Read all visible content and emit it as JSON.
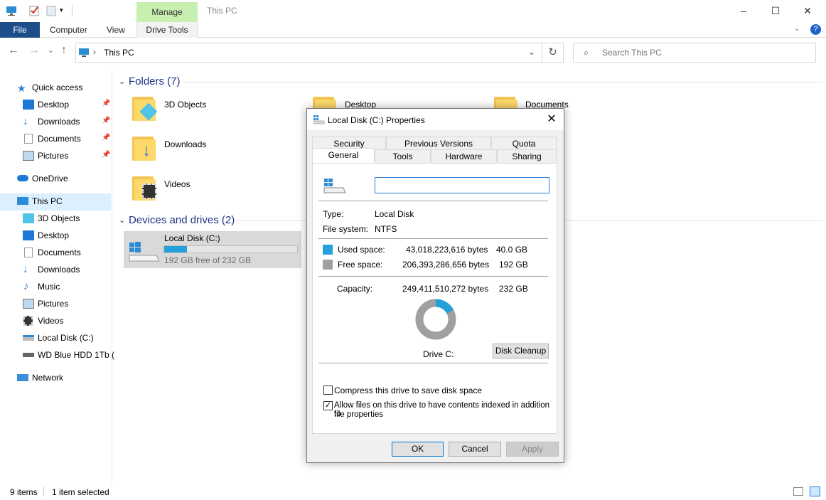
{
  "window": {
    "title": "This PC",
    "manage_tab": "Manage",
    "controls": {
      "minimize": "–",
      "maximize": "☐",
      "close": "✕"
    }
  },
  "ribbon": {
    "tabs": [
      "File",
      "Computer",
      "View",
      "Drive Tools"
    ]
  },
  "address": {
    "path": "This PC",
    "search_placeholder": "Search This PC"
  },
  "sidebar": {
    "quick_access": "Quick access",
    "quick_items": [
      "Desktop",
      "Downloads",
      "Documents",
      "Pictures"
    ],
    "onedrive": "OneDrive",
    "this_pc": "This PC",
    "pc_items": [
      "3D Objects",
      "Desktop",
      "Documents",
      "Downloads",
      "Music",
      "Pictures",
      "Videos",
      "Local Disk (C:)",
      "WD Blue HDD 1Tb ("
    ],
    "network": "Network"
  },
  "content": {
    "folders_header": "Folders (7)",
    "folders": [
      "3D Objects",
      "Desktop",
      "Documents",
      "Downloads",
      "Videos"
    ],
    "devices_header": "Devices and drives (2)",
    "drive": {
      "name": "Local Disk (C:)",
      "free_text": "192 GB free of 232 GB",
      "used_fraction": 0.17
    }
  },
  "status": {
    "items": "9 items",
    "selected": "1 item selected"
  },
  "dialog": {
    "title": "Local Disk (C:) Properties",
    "tabs_top": [
      "Security",
      "Previous Versions",
      "Quota"
    ],
    "tabs_bottom": [
      "General",
      "Tools",
      "Hardware",
      "Sharing"
    ],
    "name_value": "",
    "type_label": "Type:",
    "type_value": "Local Disk",
    "fs_label": "File system:",
    "fs_value": "NTFS",
    "used_label": "Used space:",
    "used_bytes": "43,018,223,616 bytes",
    "used_gb": "40.0 GB",
    "free_label": "Free space:",
    "free_bytes": "206,393,286,656 bytes",
    "free_gb": "192 GB",
    "capacity_label": "Capacity:",
    "capacity_bytes": "249,411,510,272 bytes",
    "capacity_gb": "232 GB",
    "drive_label": "Drive C:",
    "cleanup_button": "Disk Cleanup",
    "compress_label": "Compress this drive to save disk space",
    "compress_checked": false,
    "index_label_1": "Allow files on this drive to have contents indexed in addition to",
    "index_label_2": "file properties",
    "index_checked": true,
    "ok": "OK",
    "cancel": "Cancel",
    "apply": "Apply",
    "colors": {
      "used": "#26a0da",
      "free": "#a0a0a0"
    },
    "used_fraction": 0.172
  }
}
